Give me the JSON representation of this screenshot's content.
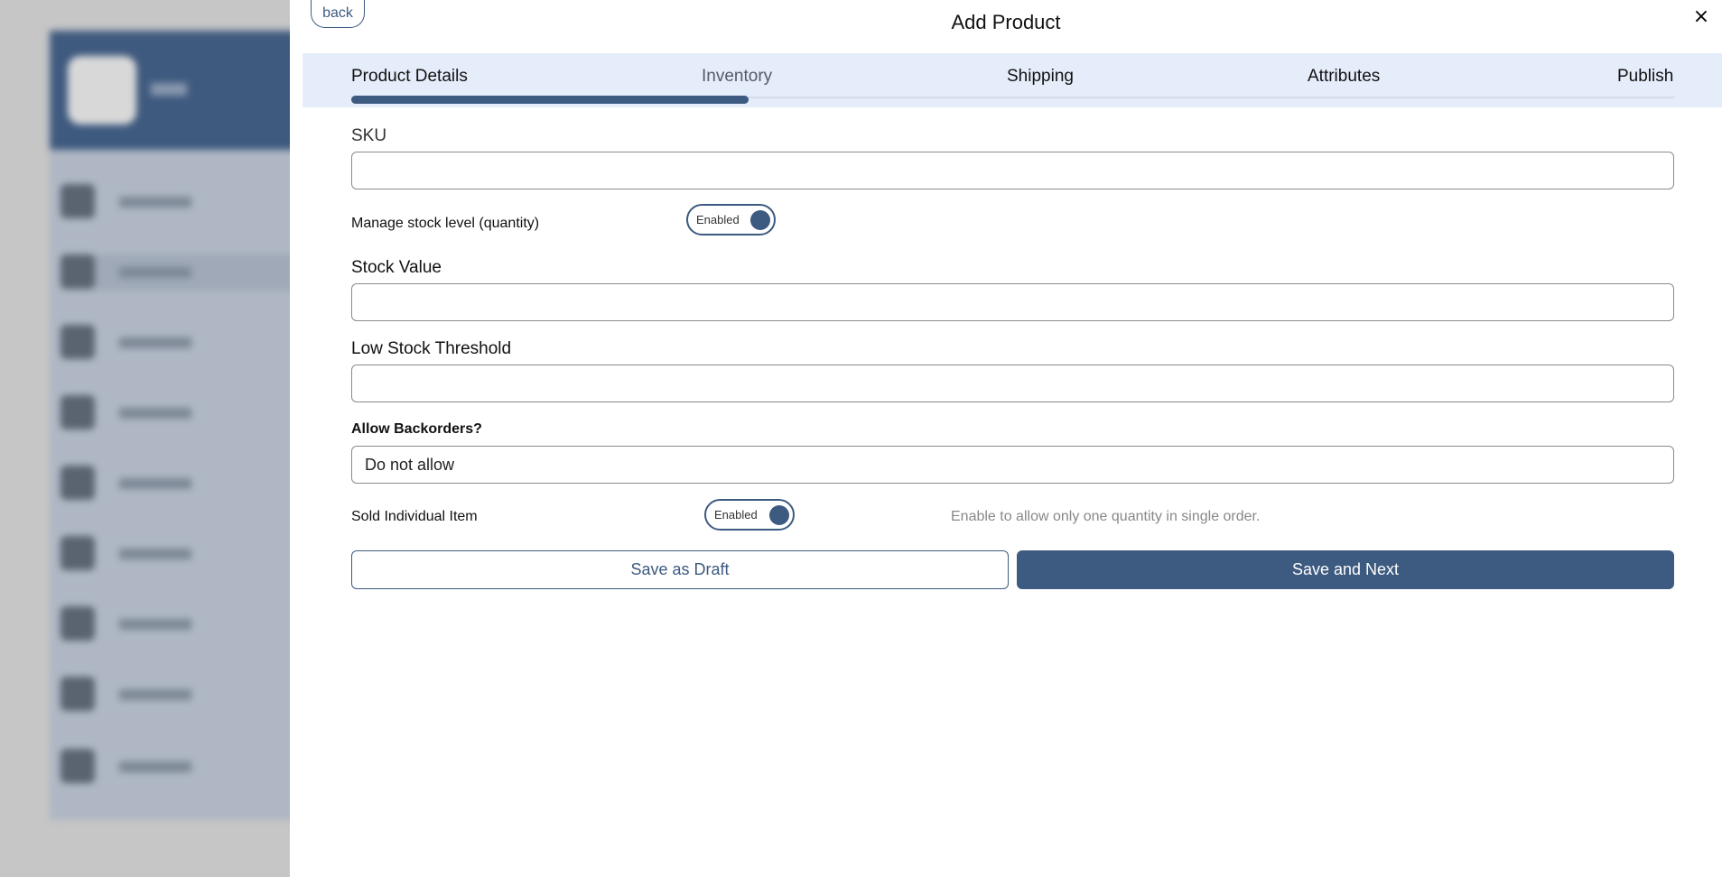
{
  "modal": {
    "title": "Add Product",
    "back_label": "back",
    "close_label": "×"
  },
  "steps": [
    {
      "label": "Product Details",
      "state": "done"
    },
    {
      "label": "Inventory",
      "state": "current"
    },
    {
      "label": "Shipping",
      "state": "pending"
    },
    {
      "label": "Attributes",
      "state": "pending"
    },
    {
      "label": "Publish",
      "state": "pending"
    }
  ],
  "progress": {
    "fraction": 0.3
  },
  "form": {
    "sku": {
      "label": "SKU",
      "value": ""
    },
    "manage_stock": {
      "label": "Manage stock level (quantity)",
      "toggle_text": "Enabled",
      "enabled": true
    },
    "stock_value": {
      "label": "Stock Value",
      "value": ""
    },
    "low_stock": {
      "label": "Low Stock Threshold",
      "value": ""
    },
    "backorders": {
      "label": "Allow Backorders?",
      "selected": "Do not allow"
    },
    "sold_individually": {
      "label": "Sold Individual Item",
      "toggle_text": "Enabled",
      "enabled": true,
      "hint": "Enable to allow only one quantity in single order."
    }
  },
  "actions": {
    "draft_label": "Save as Draft",
    "next_label": "Save and Next"
  },
  "colors": {
    "accent": "#3d5a80",
    "steps_bg": "#e5edfa"
  }
}
